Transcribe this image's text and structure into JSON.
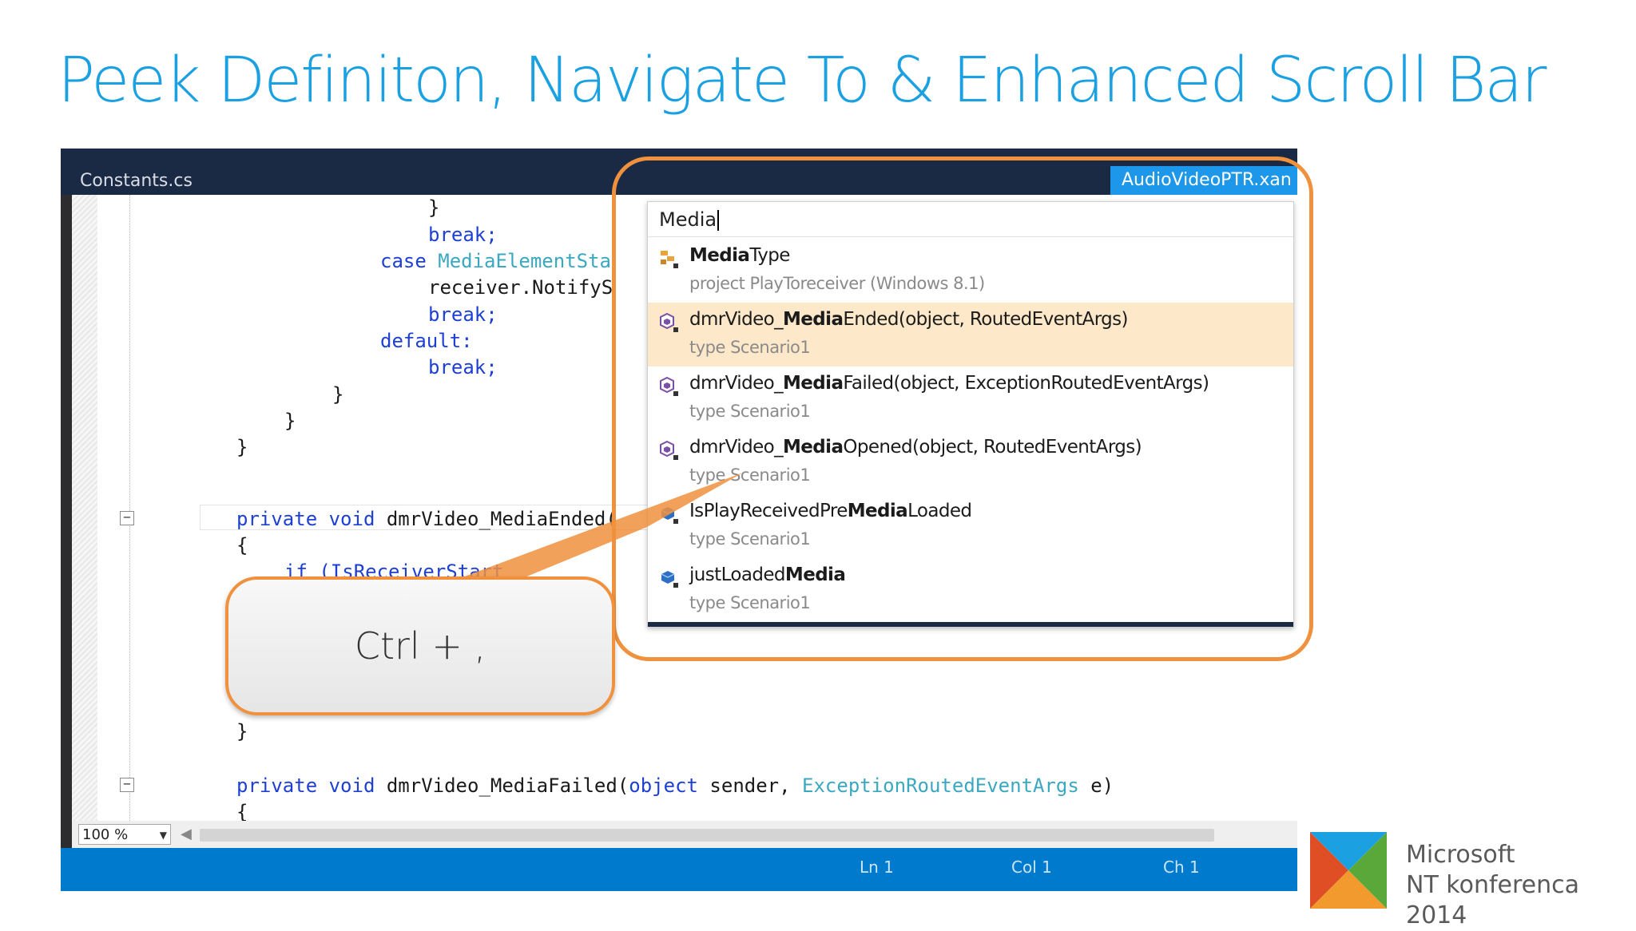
{
  "slide": {
    "title": "Peek Definiton, Navigate To & Enhanced Scroll Bar"
  },
  "ide": {
    "tab_left": "Constants.cs",
    "tab_right": "AudioVideoPTR.xan",
    "zoom": "100 %",
    "status": {
      "line": "Ln 1",
      "col": "Col 1",
      "ch": "Ch 1"
    }
  },
  "navigate_to": {
    "query": "Media",
    "results": [
      {
        "pre": "",
        "match": "Media",
        "post": "Type",
        "desc": "project PlayToreceiver (Windows 8.1)",
        "icon": "class-icon",
        "selected": false
      },
      {
        "pre": "dmrVideo_",
        "match": "Media",
        "post": "Ended(object, RoutedEventArgs)",
        "desc": "type Scenario1",
        "icon": "method-icon",
        "selected": true
      },
      {
        "pre": "dmrVideo_",
        "match": "Media",
        "post": "Failed(object, ExceptionRoutedEventArgs)",
        "desc": "type Scenario1",
        "icon": "method-icon",
        "selected": false
      },
      {
        "pre": "dmrVideo_",
        "match": "Media",
        "post": "Opened(object, RoutedEventArgs)",
        "desc": "type Scenario1",
        "icon": "method-icon",
        "selected": false
      },
      {
        "pre": "IsPlayReceivedPre",
        "match": "Media",
        "post": "Loaded",
        "desc": "type Scenario1",
        "icon": "field-icon",
        "selected": false
      },
      {
        "pre": "justLoaded",
        "match": "Media",
        "post": "",
        "desc": "type Scenario1",
        "icon": "field-icon",
        "selected": false
      }
    ]
  },
  "callout": {
    "text": "Ctrl + ,"
  },
  "code": {
    "brace_close": "}",
    "brace_open": "{",
    "break_kw": "break;",
    "case_kw": "case ",
    "case_type": "MediaElementSta",
    "notify": "receiver.NotifyS",
    "default_kw": "default:",
    "private_void": "private void ",
    "method_ended": "dmrVideo_MediaEnded(",
    "if_line": "if (IsReceiverStart",
    "method_failed": "dmrVideo_MediaFailed(",
    "object_kw": "object",
    "sender": " sender, ",
    "exc_type": "ExceptionRoutedEventArgs",
    "e_close": " e)"
  },
  "brand": {
    "line1": "Microsoft",
    "line2": "NT konferenca 2014"
  }
}
